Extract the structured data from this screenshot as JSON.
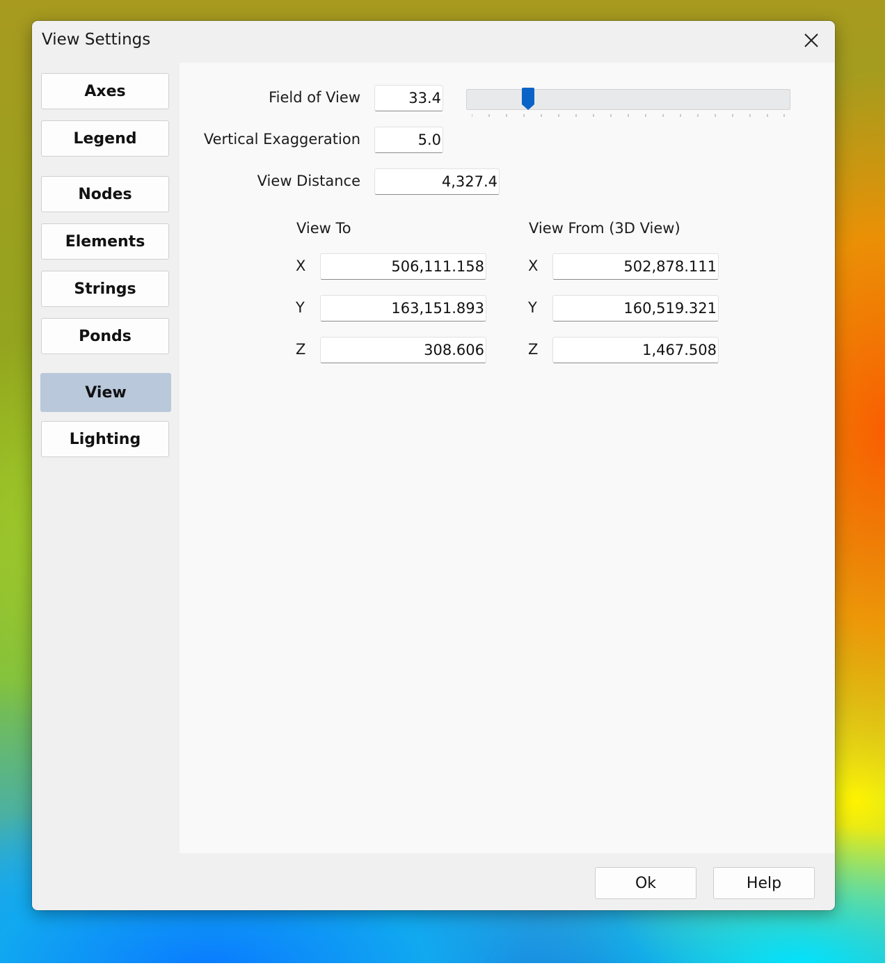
{
  "window": {
    "title": "View Settings"
  },
  "sidebar": {
    "items": [
      {
        "label": "Axes"
      },
      {
        "label": "Legend"
      },
      {
        "label": "Nodes"
      },
      {
        "label": "Elements"
      },
      {
        "label": "Strings"
      },
      {
        "label": "Ponds"
      },
      {
        "label": "View",
        "active": true
      },
      {
        "label": "Lighting"
      }
    ]
  },
  "view": {
    "field_of_view": {
      "label": "Field of View",
      "value": "33.4"
    },
    "vertical_exaggeration": {
      "label": "Vertical Exaggeration",
      "value": "5.0"
    },
    "view_distance": {
      "label": "View Distance",
      "value": "4,327.4"
    },
    "view_to": {
      "heading": "View To",
      "x": {
        "label": "X",
        "value": "506,111.158"
      },
      "y": {
        "label": "Y",
        "value": "163,151.893"
      },
      "z": {
        "label": "Z",
        "value": "308.606"
      }
    },
    "view_from": {
      "heading": "View From (3D View)",
      "x": {
        "label": "X",
        "value": "502,878.111"
      },
      "y": {
        "label": "Y",
        "value": "160,519.321"
      },
      "z": {
        "label": "Z",
        "value": "1,467.508"
      }
    }
  },
  "footer": {
    "ok_label": "Ok",
    "help_label": "Help"
  },
  "colors": {
    "accent": "#0a64c8",
    "active_nav": "#b9c8db"
  }
}
